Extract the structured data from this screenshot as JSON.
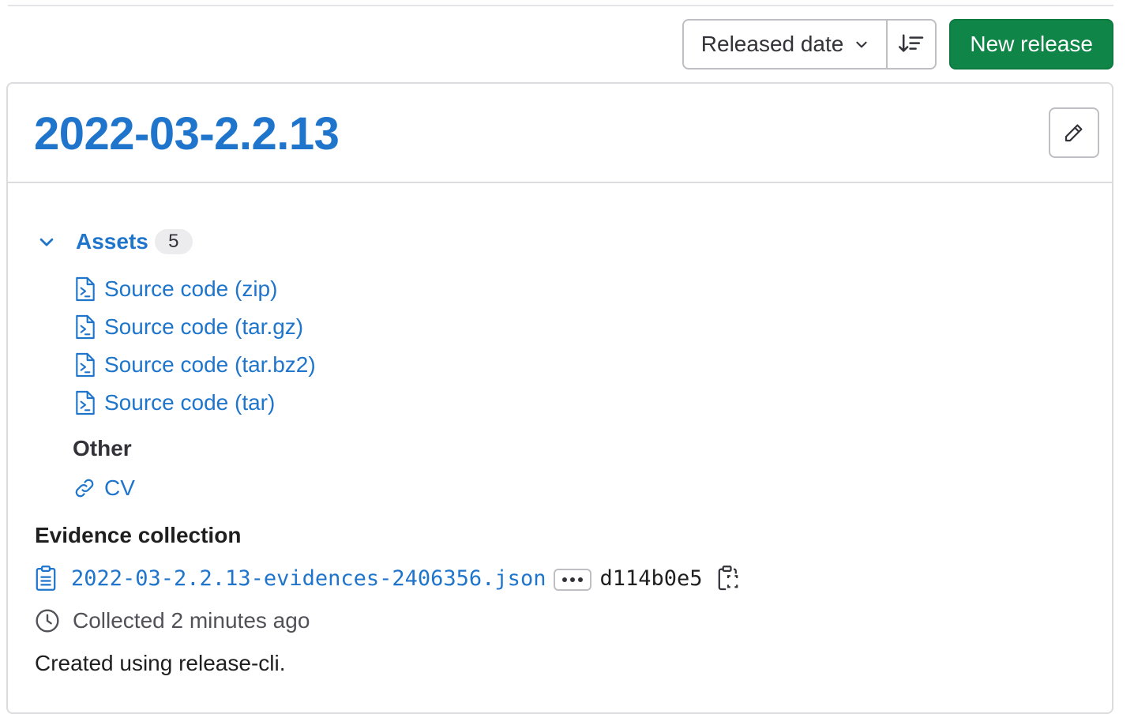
{
  "toolbar": {
    "sort_label": "Released date",
    "new_release_label": "New release"
  },
  "release": {
    "title": "2022-03-2.2.13",
    "assets": {
      "label": "Assets",
      "count": "5",
      "sources": [
        "Source code (zip)",
        "Source code (tar.gz)",
        "Source code (tar.bz2)",
        "Source code (tar)"
      ],
      "other_heading": "Other",
      "other_links": [
        "CV"
      ]
    },
    "evidence": {
      "heading": "Evidence collection",
      "file": "2022-03-2.2.13-evidences-2406356.json",
      "sha": "d114b0e5",
      "collected": "Collected 2 minutes ago"
    },
    "description": "Created using release-cli."
  },
  "colors": {
    "link": "#1f75cb",
    "primary_button": "#108548",
    "border": "#dcdcde"
  }
}
